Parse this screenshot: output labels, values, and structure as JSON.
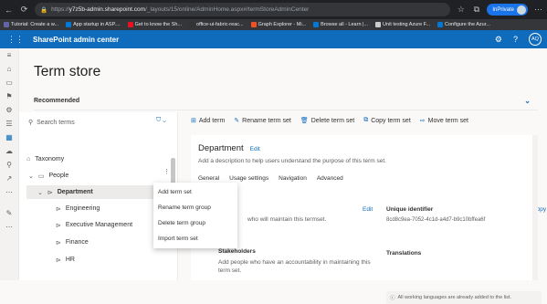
{
  "browser": {
    "url_prefix": "https://",
    "url_host": "y7z5b-admin.sharepoint.com",
    "url_path": "/_layouts/15/online/AdminHome.aspx#/termStoreAdminCenter",
    "inprivate_label": "InPrivate"
  },
  "bookmarks": [
    {
      "label": "Tutorial: Create a w...",
      "color": "#6264a7"
    },
    {
      "label": "App startup in ASP....",
      "color": "#0078d4"
    },
    {
      "label": "Get to know the Sh...",
      "color": "#e81123"
    },
    {
      "label": "office-ui-fabric-reac...",
      "color": "#333333"
    },
    {
      "label": "Graph Explorer - Mi...",
      "color": "#f25022"
    },
    {
      "label": "Browse all - Learn |...",
      "color": "#0078d4"
    },
    {
      "label": "Unit testing Azure F...",
      "color": "#cccccc"
    },
    {
      "label": "Configure the Azur...",
      "color": "#0078d4"
    }
  ],
  "header": {
    "app_title": "SharePoint admin center",
    "help": "?",
    "avatar": "AQ"
  },
  "page": {
    "title": "Term store",
    "recommended": "Recommended"
  },
  "leftpane": {
    "search_placeholder": "Search terms",
    "tree": {
      "taxonomy": "Taxonomy",
      "people": "People",
      "department": "Department",
      "terms": [
        "Engineering",
        "Executive Management",
        "Finance",
        "HR"
      ]
    }
  },
  "context_menu": [
    "Add term set",
    "Rename term group",
    "Delete term group",
    "Import term set"
  ],
  "commands": [
    "Add term",
    "Rename term set",
    "Delete term set",
    "Copy term set",
    "Move term set"
  ],
  "detail": {
    "title": "Department",
    "edit": "Edit",
    "description": "Add a description to help users understand the purpose of this term set.",
    "tabs": [
      "General",
      "Usage settings",
      "Navigation",
      "Advanced"
    ],
    "owner_text": "who will maintain this termset.",
    "owner_edit": "Edit",
    "unique_id_label": "Unique identifier",
    "unique_id_value": "8cd8c9ea-7052-4c1d-a4d7-b9c10bffea6f",
    "copy": "Copy",
    "stakeholders_label": "Stakeholders",
    "stakeholders_desc_1": "Add people who have an accountability in maintaining this",
    "stakeholders_desc_2": "term set.",
    "translations_label": "Translations",
    "translations_banner": "All working languages are already added to the list."
  }
}
